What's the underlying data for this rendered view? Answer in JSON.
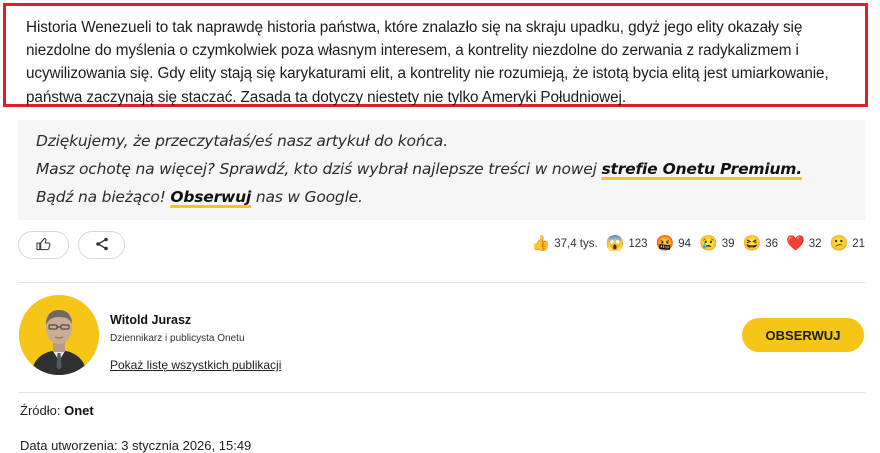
{
  "article": {
    "last_paragraph": "Historia Wenezueli to tak naprawdę historia państwa, które znalazło się na skraju upadku, gdyż jego elity okazały się niezdolne do myślenia o czymkolwiek poza własnym interesem, a kontrelity niezdolne do zerwania z radykalizmem i ucywilizowania się. Gdy elity stają się karykaturami elit, a kontrelity nie rozumieją, że istotą bycia elitą jest umiarkowanie, państwa zaczynają się staczać. Zasada ta dotyczy niestety nie tylko Ameryki Południowej."
  },
  "thanks": {
    "line1": "Dziękujemy, że przeczytałaś/eś nasz artykuł do końca.",
    "line2_prefix": "Masz ochotę na więcej? Sprawdź, kto dziś wybrał najlepsze treści w nowej ",
    "line2_link": "strefie Onetu Premium.",
    "line3_prefix": "Bądź na bieżąco! ",
    "line3_link": "Obserwuj",
    "line3_suffix": " nas w Google."
  },
  "actions": {
    "like_icon": "thumb-up-icon",
    "share_icon": "share-icon"
  },
  "reactions": [
    {
      "icon": "thumbs-up-emoji",
      "glyph": "👍",
      "count": "37,4 tys."
    },
    {
      "icon": "shocked-emoji",
      "glyph": "😱",
      "count": "123"
    },
    {
      "icon": "angry-emoji",
      "glyph": "🤬",
      "count": "94"
    },
    {
      "icon": "crying-emoji",
      "glyph": "😢",
      "count": "39"
    },
    {
      "icon": "laughing-emoji",
      "glyph": "😆",
      "count": "36"
    },
    {
      "icon": "heart-emoji",
      "glyph": "❤️",
      "count": "32"
    },
    {
      "icon": "confused-emoji",
      "glyph": "😕",
      "count": "21"
    }
  ],
  "author": {
    "name": "Witold Jurasz",
    "role": "Dziennikarz i publicysta Onetu",
    "all_publications_link": "Pokaż listę wszystkich publikacji",
    "follow_label": "OBSERWUJ"
  },
  "source": {
    "label": "Źródło:",
    "value": "Onet"
  },
  "created": {
    "label": "Data utworzenia:",
    "value": "3 stycznia 2026, 15:49"
  },
  "colors": {
    "accent_yellow": "#f5c518",
    "highlight_red": "#e01f26"
  }
}
